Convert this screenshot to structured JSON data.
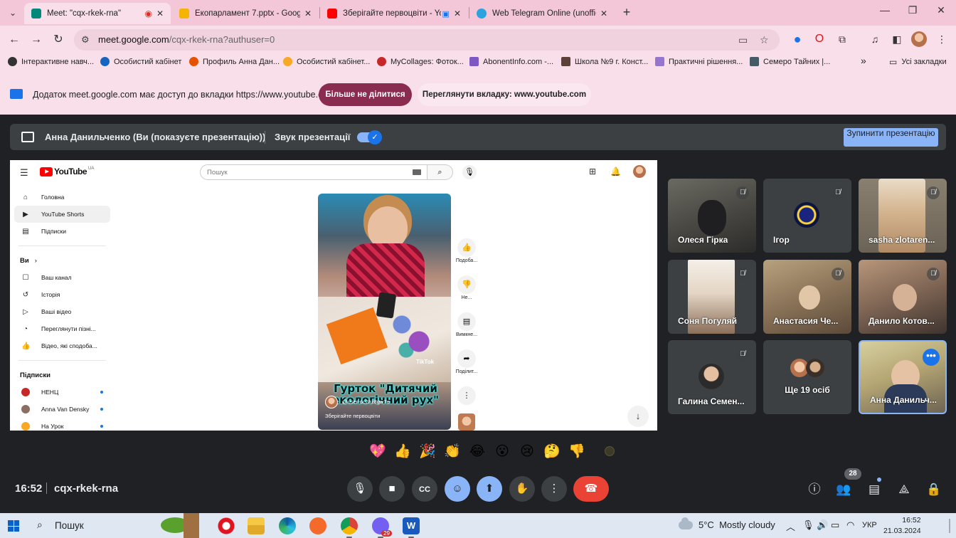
{
  "browser": {
    "tabs": [
      {
        "title": "Meet: \"cqx-rkek-rna\"",
        "favicon_color": "#00897b"
      },
      {
        "title": "Екопарламент 7.pptx - Google",
        "favicon_color": "#f4b400"
      },
      {
        "title": "Зберігайте первоцвіти - Yo",
        "favicon_color": "#ff0000"
      },
      {
        "title": "Web Telegram Online (unofficia",
        "favicon_color": "#2aa3df"
      }
    ],
    "url_host": "meet.google.com",
    "url_path": "/cqx-rkek-rna?authuser=0",
    "bookmarks": [
      "Інтерактивне навч...",
      "Особистий кабінет",
      "Профиль Анна Дан...",
      "Особистий кабінет...",
      "MyCollages: Фоток...",
      "AbonentInfo.com -...",
      "Школа №9 г. Конст...",
      "Практичні рішення...",
      "Семеро Тайних |..."
    ],
    "all_bookmarks": "Усі закладки",
    "share_message": "Додаток meet.google.com має доступ до вкладки https://www.youtube.com",
    "stop_sharing": "Більше не ділитися",
    "view_tab": "Переглянути вкладку: www.youtube.com"
  },
  "meet": {
    "presenting_text": "Анна Данильченко (Ви (показуєте презентацію))",
    "sound_label": "Звук презентації",
    "stop_presenting": "Зупинити презентацію",
    "time": "16:52",
    "code": "cqx-rkek-rna",
    "people_count": "28",
    "participants": [
      {
        "name": "Олеся Гірка"
      },
      {
        "name": "Ігор"
      },
      {
        "name": "sasha zlotaren..."
      },
      {
        "name": "Соня Погуляй"
      },
      {
        "name": "Анастасия Че..."
      },
      {
        "name": "Данило Котов..."
      },
      {
        "name": "Галина Семен..."
      },
      {
        "name": "Ще 19 осіб"
      },
      {
        "name": "Анна Данильч..."
      }
    ],
    "reactions": [
      "💖",
      "👍",
      "🎉",
      "👏",
      "😂",
      "😮",
      "😢",
      "🤔",
      "👎"
    ]
  },
  "youtube": {
    "search_placeholder": "Пошук",
    "country": "UA",
    "side_main": [
      {
        "label": "Головна",
        "icon": "home-icon"
      },
      {
        "label": "YouTube Shorts",
        "icon": "shorts-icon"
      },
      {
        "label": "Підписки",
        "icon": "subscriptions-icon"
      }
    ],
    "you_label": "Ви",
    "side_you": [
      {
        "label": "Ваш канал",
        "icon": "channel-icon"
      },
      {
        "label": "Історія",
        "icon": "history-icon"
      },
      {
        "label": "Ваші відео",
        "icon": "your-videos-icon"
      },
      {
        "label": "Переглянути пізні...",
        "icon": "watch-later-icon"
      },
      {
        "label": "Відео, які сподоба...",
        "icon": "liked-icon"
      }
    ],
    "subs_label": "Підписки",
    "subs": [
      {
        "label": "НЕНЦ",
        "color": "#c62828"
      },
      {
        "label": "Anna Van Densky",
        "color": "#8d6e63"
      },
      {
        "label": "На Урок",
        "color": "#f9a825"
      }
    ],
    "short": {
      "caption_line1": "Гурток \"Дитячий",
      "caption_line2": "екологічний рух\"",
      "user": "@user-dc2hz8gw7e",
      "title": "Зберігайте первоцвіти",
      "watermark": "TikTok"
    },
    "actions": [
      "Подоба...",
      "Не...",
      "Вимкне...",
      "Поділит..."
    ]
  },
  "taskbar": {
    "search": "Пошук",
    "temperature": "5°C",
    "weather": "Mostly cloudy",
    "lang": "УКР",
    "time": "16:52",
    "date": "21.03.2024",
    "chrome_badge": "29"
  }
}
